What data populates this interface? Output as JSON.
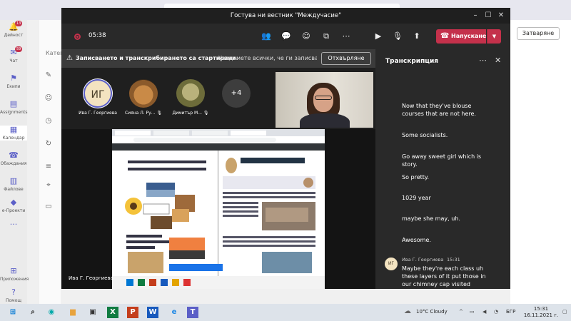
{
  "app": {
    "rail": [
      {
        "label": "Дейност",
        "badge": "13",
        "icon": "bell"
      },
      {
        "label": "Чат",
        "badge": "59",
        "icon": "chat"
      },
      {
        "label": "Екипи",
        "badge": "",
        "icon": "teams"
      },
      {
        "label": "Assignments",
        "badge": "",
        "icon": "assign"
      },
      {
        "label": "Календар",
        "badge": "",
        "icon": "calendar"
      },
      {
        "label": "Обаждания",
        "badge": "",
        "icon": "phone"
      },
      {
        "label": "Файлове",
        "badge": "",
        "icon": "files"
      },
      {
        "label": "e-Проекти",
        "badge": "",
        "icon": "projects"
      },
      {
        "label": "...",
        "badge": "",
        "icon": "more"
      },
      {
        "label": "Приложения",
        "badge": "",
        "icon": "apps"
      },
      {
        "label": "Помощ",
        "badge": "",
        "icon": "help"
      }
    ],
    "category_label": "Катег",
    "close_button": "Затваряне"
  },
  "call": {
    "title": "Гостува ни вестник \"Междучасие\"",
    "timer": "05:38",
    "leave_label": "Напускане",
    "notice": {
      "bold": "Записването и транскрибирането са стартирани.",
      "text": "Уведомете всички, че ги записва...",
      "dismiss": "Отхвърляне"
    },
    "participants": [
      {
        "name": "Ива Г. Георгиева",
        "initials": "ИГ"
      },
      {
        "name": "Сияна Л. Ру...",
        "initials": ""
      },
      {
        "name": "Димитър М...",
        "initials": ""
      },
      {
        "name": "",
        "initials": "+4"
      }
    ],
    "sharer": "Ива Г. Георгиева"
  },
  "transcript": {
    "title": "Транскрипция",
    "lines": [
      "Now that they've blouse courses that are not here.",
      "Some socialists.",
      "Go away sweet girl which is story.",
      "So pretty.",
      "1029 year",
      "maybe she may, uh.",
      "Awesome."
    ],
    "last": {
      "initials": "ИГ",
      "speaker": "Ива Г. Георгиева",
      "time": "15:31",
      "text": "Maybe they're each class uh these layers of it put those in our chimney cap visited"
    }
  },
  "taskbar": {
    "weather": "10°C  Cloudy",
    "lang": "БГР",
    "time": "15:31",
    "date": "16.11.2021 г."
  },
  "colors": {
    "accent": "#5b5fc7",
    "leave": "#c4314b"
  }
}
